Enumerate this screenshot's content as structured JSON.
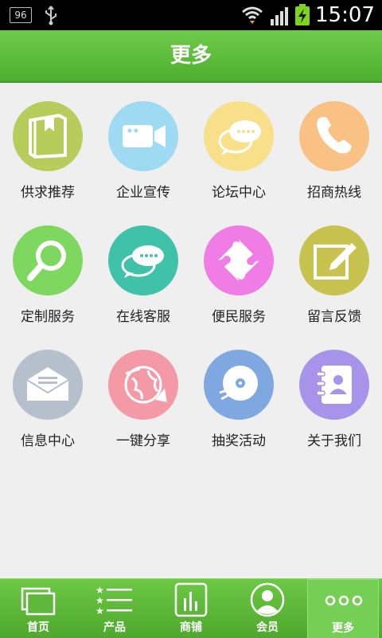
{
  "status_bar": {
    "badge": "96",
    "time": "15:07"
  },
  "header": {
    "title": "更多"
  },
  "grid": [
    {
      "label": "供求推荐",
      "color": "#b7cc5a",
      "icon": "book-icon"
    },
    {
      "label": "企业宣传",
      "color": "#9fdaf3",
      "icon": "video-camera-icon"
    },
    {
      "label": "论坛中心",
      "color": "#f8e08a",
      "icon": "chat-bubbles-icon"
    },
    {
      "label": "招商热线",
      "color": "#f9c183",
      "icon": "phone-icon"
    },
    {
      "label": "定制服务",
      "color": "#7ed85f",
      "icon": "magnifier-icon"
    },
    {
      "label": "在线客服",
      "color": "#3fc2a9",
      "icon": "chat-bubbles-icon"
    },
    {
      "label": "便民服务",
      "color": "#f07ce6",
      "icon": "puzzle-icon"
    },
    {
      "label": "留言反馈",
      "color": "#c7c34e",
      "icon": "edit-icon"
    },
    {
      "label": "信息中心",
      "color": "#b6bfcc",
      "icon": "envelope-icon"
    },
    {
      "label": "一键分享",
      "color": "#f39aa6",
      "icon": "share-globe-icon"
    },
    {
      "label": "抽奖活动",
      "color": "#7fa8e0",
      "icon": "disc-icon"
    },
    {
      "label": "关于我们",
      "color": "#a793ea",
      "icon": "contacts-book-icon"
    }
  ],
  "tabbar": [
    {
      "label": "首页",
      "icon": "home-windows-icon"
    },
    {
      "label": "产品",
      "icon": "list-stars-icon"
    },
    {
      "label": "商铺",
      "icon": "shop-bars-icon"
    },
    {
      "label": "会员",
      "icon": "member-avatar-icon"
    },
    {
      "label": "更多",
      "icon": "more-dots-icon",
      "active": true
    }
  ]
}
